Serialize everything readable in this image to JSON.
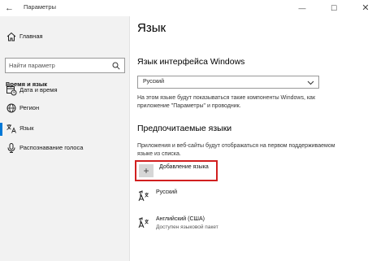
{
  "window": {
    "title": "Параметры",
    "back": "←",
    "minimize": "—",
    "maximize": "☐",
    "close": "✕"
  },
  "sidebar": {
    "home": "Главная",
    "search_placeholder": "Найти параметр",
    "section": "Время и язык",
    "items": [
      {
        "label": "Дата и время",
        "icon": "calendar-clock-icon"
      },
      {
        "label": "Регион",
        "icon": "globe-icon"
      },
      {
        "label": "Язык",
        "icon": "language-icon",
        "active": true
      },
      {
        "label": "Распознавание голоса",
        "icon": "microphone-icon"
      }
    ]
  },
  "main": {
    "title": "Язык",
    "display_language": {
      "heading": "Язык интерфейса Windows",
      "selected": "Русский",
      "description": "На этом языке будут показываться такие компоненты Windows, как приложение \"Параметры\" и проводник."
    },
    "preferred": {
      "heading": "Предпочитаемые языки",
      "description": "Приложения и веб-сайты будут отображаться на первом поддерживаемом языке из списка.",
      "add_label": "Добавление языка",
      "languages": [
        {
          "name": "Русский",
          "sub": ""
        },
        {
          "name": "Английский (США)",
          "sub": "Доступен языковой пакет"
        }
      ]
    }
  },
  "colors": {
    "accent": "#0078d7",
    "highlight": "#d11f1f",
    "sidebar_bg": "#f2f2f2"
  }
}
